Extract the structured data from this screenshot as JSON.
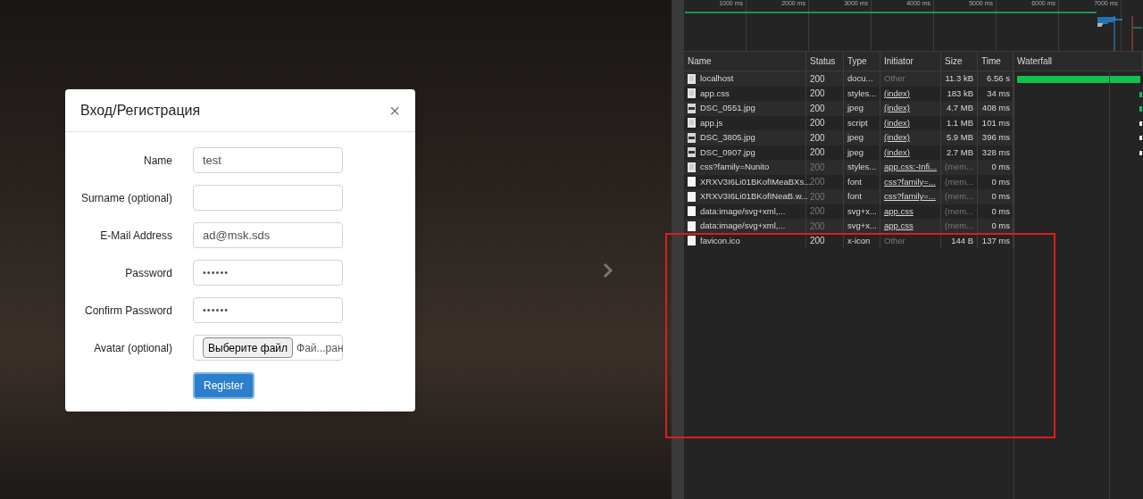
{
  "modal": {
    "title": "Вход/Регистрация",
    "close": "×",
    "fields": [
      {
        "kind": "text",
        "label": "Name",
        "value": "test"
      },
      {
        "kind": "text",
        "label": "Surname (optional)"
      },
      {
        "kind": "text",
        "label": "E-Mail Address",
        "value": "ad@msk.sds"
      },
      {
        "kind": "password",
        "label": "Password",
        "value": "••••••"
      },
      {
        "kind": "password",
        "label": "Confirm Password",
        "value": "••••••"
      },
      {
        "kind": "file",
        "label": "Avatar (optional)",
        "button": "Выберите файл",
        "value": "Фай...ран"
      }
    ],
    "submit": "Register"
  },
  "timeline": {
    "ticks": [
      "1000 ms",
      "2000 ms",
      "3000 ms",
      "4000 ms",
      "5000 ms",
      "6000 ms",
      "7000 ms"
    ]
  },
  "network": {
    "columns": [
      "Name",
      "Status",
      "Type",
      "Initiator",
      "Size",
      "Time",
      "Waterfall"
    ],
    "rows": [
      {
        "kind": "document",
        "name": "localhost",
        "status": "200",
        "type": "docu...",
        "initiator": "Other",
        "initiator_link": false,
        "size": "11.3 kB",
        "time": "6.56 s",
        "cached": false
      },
      {
        "kind": "document",
        "name": "app.css",
        "status": "200",
        "type": "styles...",
        "initiator": "(index)",
        "initiator_link": true,
        "size": "183 kB",
        "time": "34 ms",
        "cached": false
      },
      {
        "kind": "image",
        "name": "DSC_0551.jpg",
        "status": "200",
        "type": "jpeg",
        "initiator": "(index)",
        "initiator_link": true,
        "size": "4.7 MB",
        "time": "408 ms",
        "cached": false
      },
      {
        "kind": "document",
        "name": "app.js",
        "status": "200",
        "type": "script",
        "initiator": "(index)",
        "initiator_link": true,
        "size": "1.1 MB",
        "time": "101 ms",
        "cached": false
      },
      {
        "kind": "image",
        "name": "DSC_3805.jpg",
        "status": "200",
        "type": "jpeg",
        "initiator": "(index)",
        "initiator_link": true,
        "size": "5.9 MB",
        "time": "396 ms",
        "cached": false
      },
      {
        "kind": "image",
        "name": "DSC_0907.jpg",
        "status": "200",
        "type": "jpeg",
        "initiator": "(index)",
        "initiator_link": true,
        "size": "2.7 MB",
        "time": "328 ms",
        "cached": false
      },
      {
        "kind": "document",
        "name": "css?family=Nunito",
        "status": "200",
        "type": "styles...",
        "initiator": "app.css:-Infi...",
        "initiator_link": true,
        "size": "(mem...",
        "time": "0 ms",
        "cached": true
      },
      {
        "kind": "blank",
        "name": "XRXV3I6Li01BKofIMeaBXs...",
        "status": "200",
        "type": "font",
        "initiator": "css?family=...",
        "initiator_link": true,
        "size": "(mem...",
        "time": "0 ms",
        "cached": true
      },
      {
        "kind": "blank",
        "name": "XRXV3I6Li01BKofINeaB.w...",
        "status": "200",
        "type": "font",
        "initiator": "css?family=...",
        "initiator_link": true,
        "size": "(mem...",
        "time": "0 ms",
        "cached": true
      },
      {
        "kind": "blank",
        "name": "data:image/svg+xml,...",
        "status": "200",
        "type": "svg+x...",
        "initiator": "app.css",
        "initiator_link": true,
        "size": "(mem...",
        "time": "0 ms",
        "cached": true
      },
      {
        "kind": "blank",
        "name": "data:image/svg+xml,...",
        "status": "200",
        "type": "svg+x...",
        "initiator": "app.css",
        "initiator_link": true,
        "size": "(mem...",
        "time": "0 ms",
        "cached": true
      },
      {
        "kind": "blank",
        "name": "favicon.ico",
        "status": "200",
        "type": "x-icon",
        "initiator": "Other",
        "initiator_link": false,
        "size": "144 B",
        "time": "137 ms",
        "cached": false
      }
    ]
  }
}
